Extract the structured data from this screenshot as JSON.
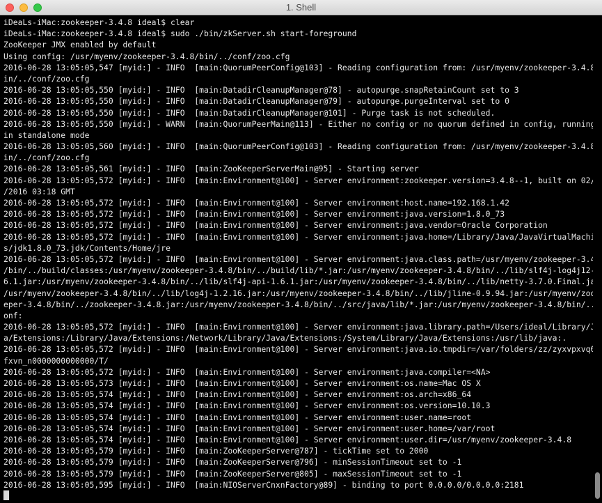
{
  "window": {
    "title": "1. Shell"
  },
  "terminal": {
    "lines": [
      "iDeaLs-iMac:zookeeper-3.4.8 ideal$ clear",
      "iDeaLs-iMac:zookeeper-3.4.8 ideal$ sudo ./bin/zkServer.sh start-foreground",
      "ZooKeeper JMX enabled by default",
      "Using config: /usr/myenv/zookeeper-3.4.8/bin/../conf/zoo.cfg",
      "2016-06-28 13:05:05,547 [myid:] - INFO  [main:QuorumPeerConfig@103] - Reading configuration from: /usr/myenv/zookeeper-3.4.8/b",
      "in/../conf/zoo.cfg",
      "2016-06-28 13:05:05,550 [myid:] - INFO  [main:DatadirCleanupManager@78] - autopurge.snapRetainCount set to 3",
      "2016-06-28 13:05:05,550 [myid:] - INFO  [main:DatadirCleanupManager@79] - autopurge.purgeInterval set to 0",
      "2016-06-28 13:05:05,550 [myid:] - INFO  [main:DatadirCleanupManager@101] - Purge task is not scheduled.",
      "2016-06-28 13:05:05,550 [myid:] - WARN  [main:QuorumPeerMain@113] - Either no config or no quorum defined in config, running",
      "in standalone mode",
      "2016-06-28 13:05:05,560 [myid:] - INFO  [main:QuorumPeerConfig@103] - Reading configuration from: /usr/myenv/zookeeper-3.4.8/b",
      "in/../conf/zoo.cfg",
      "2016-06-28 13:05:05,561 [myid:] - INFO  [main:ZooKeeperServerMain@95] - Starting server",
      "2016-06-28 13:05:05,572 [myid:] - INFO  [main:Environment@100] - Server environment:zookeeper.version=3.4.8--1, built on 02/06",
      "/2016 03:18 GMT",
      "2016-06-28 13:05:05,572 [myid:] - INFO  [main:Environment@100] - Server environment:host.name=192.168.1.42",
      "2016-06-28 13:05:05,572 [myid:] - INFO  [main:Environment@100] - Server environment:java.version=1.8.0_73",
      "2016-06-28 13:05:05,572 [myid:] - INFO  [main:Environment@100] - Server environment:java.vendor=Oracle Corporation",
      "2016-06-28 13:05:05,572 [myid:] - INFO  [main:Environment@100] - Server environment:java.home=/Library/Java/JavaVirtualMachine",
      "s/jdk1.8.0_73.jdk/Contents/Home/jre",
      "2016-06-28 13:05:05,572 [myid:] - INFO  [main:Environment@100] - Server environment:java.class.path=/usr/myenv/zookeeper-3.4.8",
      "/bin/../build/classes:/usr/myenv/zookeeper-3.4.8/bin/../build/lib/*.jar:/usr/myenv/zookeeper-3.4.8/bin/../lib/slf4j-log4j12-1.",
      "6.1.jar:/usr/myenv/zookeeper-3.4.8/bin/../lib/slf4j-api-1.6.1.jar:/usr/myenv/zookeeper-3.4.8/bin/../lib/netty-3.7.0.Final.jar:",
      "/usr/myenv/zookeeper-3.4.8/bin/../lib/log4j-1.2.16.jar:/usr/myenv/zookeeper-3.4.8/bin/../lib/jline-0.9.94.jar:/usr/myenv/zooke",
      "eper-3.4.8/bin/../zookeeper-3.4.8.jar:/usr/myenv/zookeeper-3.4.8/bin/../src/java/lib/*.jar:/usr/myenv/zookeeper-3.4.8/bin/../c",
      "onf:",
      "2016-06-28 13:05:05,572 [myid:] - INFO  [main:Environment@100] - Server environment:java.library.path=/Users/ideal/Library/Jav",
      "a/Extensions:/Library/Java/Extensions:/Network/Library/Java/Extensions:/System/Library/Java/Extensions:/usr/lib/java:.",
      "2016-06-28 13:05:05,572 [myid:] - INFO  [main:Environment@100] - Server environment:java.io.tmpdir=/var/folders/zz/zyxvpxvq6cs",
      "fxvn_n0000000000000/T/",
      "2016-06-28 13:05:05,572 [myid:] - INFO  [main:Environment@100] - Server environment:java.compiler=<NA>",
      "2016-06-28 13:05:05,573 [myid:] - INFO  [main:Environment@100] - Server environment:os.name=Mac OS X",
      "2016-06-28 13:05:05,574 [myid:] - INFO  [main:Environment@100] - Server environment:os.arch=x86_64",
      "2016-06-28 13:05:05,574 [myid:] - INFO  [main:Environment@100] - Server environment:os.version=10.10.3",
      "2016-06-28 13:05:05,574 [myid:] - INFO  [main:Environment@100] - Server environment:user.name=root",
      "2016-06-28 13:05:05,574 [myid:] - INFO  [main:Environment@100] - Server environment:user.home=/var/root",
      "2016-06-28 13:05:05,574 [myid:] - INFO  [main:Environment@100] - Server environment:user.dir=/usr/myenv/zookeeper-3.4.8",
      "2016-06-28 13:05:05,579 [myid:] - INFO  [main:ZooKeeperServer@787] - tickTime set to 2000",
      "2016-06-28 13:05:05,579 [myid:] - INFO  [main:ZooKeeperServer@796] - minSessionTimeout set to -1",
      "2016-06-28 13:05:05,579 [myid:] - INFO  [main:ZooKeeperServer@805] - maxSessionTimeout set to -1",
      "2016-06-28 13:05:05,595 [myid:] - INFO  [main:NIOServerCnxnFactory@89] - binding to port 0.0.0.0/0.0.0.0:2181"
    ]
  }
}
